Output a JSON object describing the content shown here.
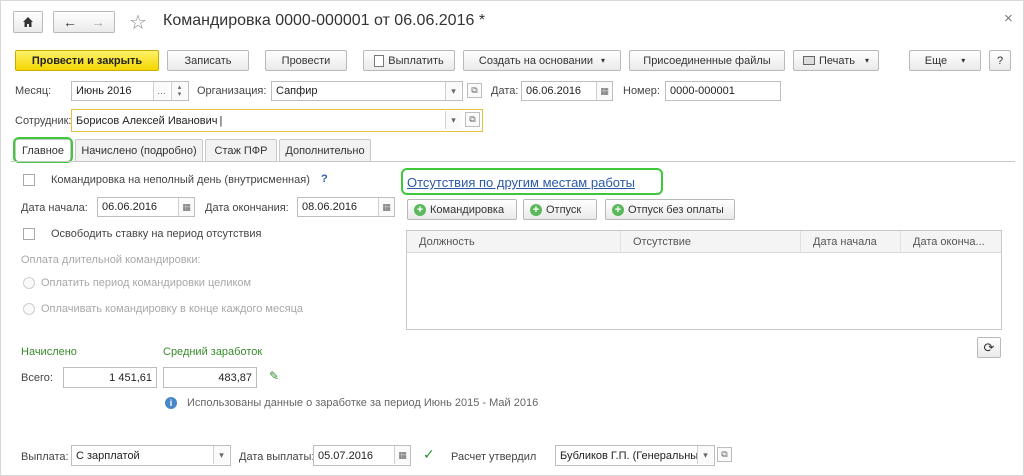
{
  "header": {
    "title": "Командировка 0000-000001 от 06.06.2016 *",
    "star_icon": "star-icon",
    "close": "×"
  },
  "toolbar": {
    "post_close": "Провести и закрыть",
    "save": "Записать",
    "post": "Провести",
    "pay": "Выплатить",
    "create_based": "Создать на основании",
    "attached_files": "Присоединенные файлы",
    "print": "Печать",
    "more": "Еще",
    "help": "?"
  },
  "form": {
    "month_label": "Месяц:",
    "month_value": "Июнь 2016",
    "org_label": "Организация:",
    "org_value": "Сапфир",
    "date_label": "Дата:",
    "date_value": "06.06.2016",
    "number_label": "Номер:",
    "number_value": "0000-000001",
    "employee_label": "Сотрудник:",
    "employee_value": "Борисов Алексей Иванович"
  },
  "tabs": [
    "Главное",
    "Начислено (подробно)",
    "Стаж ПФР",
    "Дополнительно"
  ],
  "main": {
    "partial_day": "Командировка на неполный день (внутрисменная)",
    "help_q": "?",
    "start_label": "Дата начала:",
    "start_value": "06.06.2016",
    "end_label": "Дата окончания:",
    "end_value": "08.06.2016",
    "release_rate": "Освободить ставку на период отсутствия",
    "long_payment": "Оплата длительной командировки:",
    "pay_whole": "Оплатить период командировки целиком",
    "pay_monthly": "Оплачивать командировку в конце каждого месяца",
    "accrued": "Начислено",
    "avg_earnings": "Средний заработок",
    "total_label": "Всего:",
    "total_value": "1 451,61",
    "avg_value": "483,87",
    "info_text": "Использованы данные о заработке за период Июнь 2015 - Май 2016"
  },
  "absences": {
    "link": "Отсутствия по другим местам работы",
    "btn_trip": "Командировка",
    "btn_vacation": "Отпуск",
    "btn_unpaid": "Отпуск без оплаты",
    "columns": [
      "Должность",
      "Отсутствие",
      "Дата начала",
      "Дата оконча..."
    ]
  },
  "footer": {
    "payout_label": "Выплата:",
    "payout_value": "С зарплатой",
    "payout_date_label": "Дата выплаты:",
    "payout_date_value": "05.07.2016",
    "approved_label": "Расчет утвердил",
    "approver_value": "Бубликов Г.П. (Генеральны"
  },
  "colors": {
    "primary": "#f3d600",
    "highlight": "#3ec83a",
    "link": "#2b5aa8",
    "accent_green": "#3a8a2e"
  }
}
